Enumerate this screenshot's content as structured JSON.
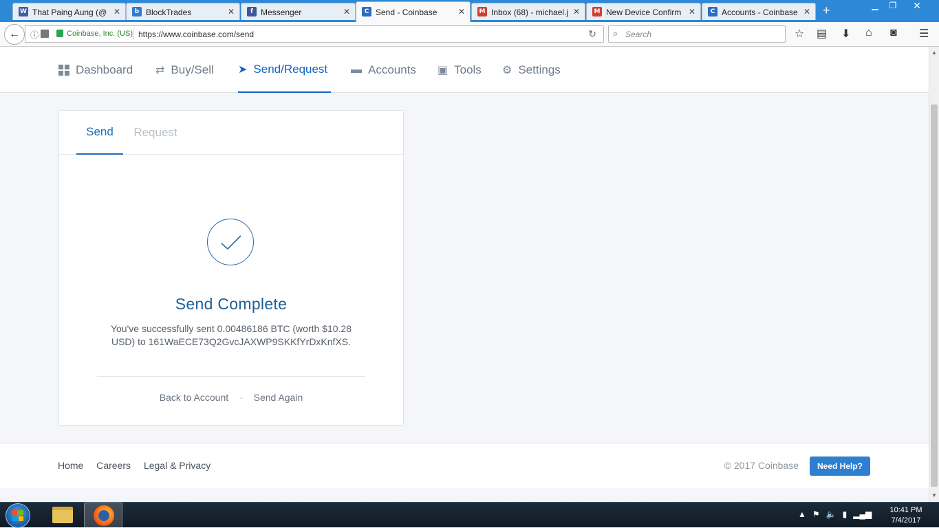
{
  "browser": {
    "tabs": [
      {
        "title": "That Paing Aung (@",
        "favicon": "W",
        "favicon_color": "#3e5fa8",
        "active": false
      },
      {
        "title": "BlockTrades",
        "favicon": "b",
        "favicon_color": "#2e7bcf",
        "active": false
      },
      {
        "title": "Messenger",
        "favicon": "f",
        "favicon_color": "#3b5998",
        "active": false
      },
      {
        "title": "Send - Coinbase",
        "favicon": "C",
        "favicon_color": "#2b6dc3",
        "active": true
      },
      {
        "title": "Inbox (68) - michael.j",
        "favicon": "M",
        "favicon_color": "#d23f31",
        "active": false
      },
      {
        "title": "New Device Confirm",
        "favicon": "M",
        "favicon_color": "#d23f31",
        "active": false
      },
      {
        "title": "Accounts - Coinbase",
        "favicon": "C",
        "favicon_color": "#2b6dc3",
        "active": false
      }
    ],
    "url_org": "Coinbase, Inc. (US)",
    "url": "https://www.coinbase.com/send",
    "search_placeholder": "Search"
  },
  "nav": {
    "items": [
      {
        "label": "Dashboard",
        "icon": "dashboard-icon",
        "active": false
      },
      {
        "label": "Buy/Sell",
        "icon": "exchange-icon",
        "active": false
      },
      {
        "label": "Send/Request",
        "icon": "send-icon",
        "active": true
      },
      {
        "label": "Accounts",
        "icon": "wallet-icon",
        "active": false
      },
      {
        "label": "Tools",
        "icon": "toolbox-icon",
        "active": false
      },
      {
        "label": "Settings",
        "icon": "gear-icon",
        "active": false
      }
    ]
  },
  "card": {
    "tabs": [
      {
        "label": "Send",
        "active": true
      },
      {
        "label": "Request",
        "active": false
      }
    ],
    "title": "Send Complete",
    "message": "You've successfully sent 0.00486186 BTC (worth $10.28 USD) to 161WaECE73Q2GvcJAXWP9SKKfYrDxKnfXS.",
    "back_label": "Back to Account",
    "separator": "·",
    "send_again_label": "Send Again"
  },
  "footer": {
    "links": [
      "Home",
      "Careers",
      "Legal & Privacy"
    ],
    "copyright": "© 2017 Coinbase",
    "help_label": "Need Help?"
  },
  "taskbar": {
    "time": "10:41 PM",
    "date": "7/4/2017"
  },
  "colors": {
    "accent": "#1565c0",
    "help_button": "#2f7fd1",
    "tabbar": "#2e88d8"
  }
}
